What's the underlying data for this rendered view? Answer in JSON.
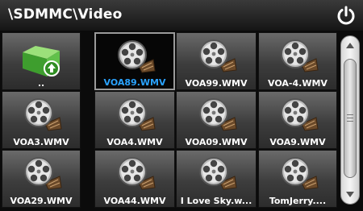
{
  "window": {
    "title": "\\SDMMC\\Video"
  },
  "icons": {
    "power": "power-icon",
    "parent": "folder-up-icon",
    "video": "film-reel-icon"
  },
  "colors": {
    "selected_label": "#2aa3ff",
    "folder_green": "#3cb371"
  },
  "files": [
    {
      "label": "..",
      "type": "parent"
    },
    {
      "label": "VOA89.WMV",
      "type": "video",
      "selected": true
    },
    {
      "label": "VOA99.WMV",
      "type": "video"
    },
    {
      "label": "VOA-4.WMV",
      "type": "video"
    },
    {
      "label": "VOA3.WMV",
      "type": "video"
    },
    {
      "label": "VOA4.WMV",
      "type": "video"
    },
    {
      "label": "VOA09.WMV",
      "type": "video"
    },
    {
      "label": "VOA9.WMV",
      "type": "video"
    },
    {
      "label": "VOA29.WMV",
      "type": "video"
    },
    {
      "label": "VOA44.WMV",
      "type": "video"
    },
    {
      "label": "I Love Sky.w...",
      "type": "video"
    },
    {
      "label": "TomJerry....",
      "type": "video"
    }
  ]
}
